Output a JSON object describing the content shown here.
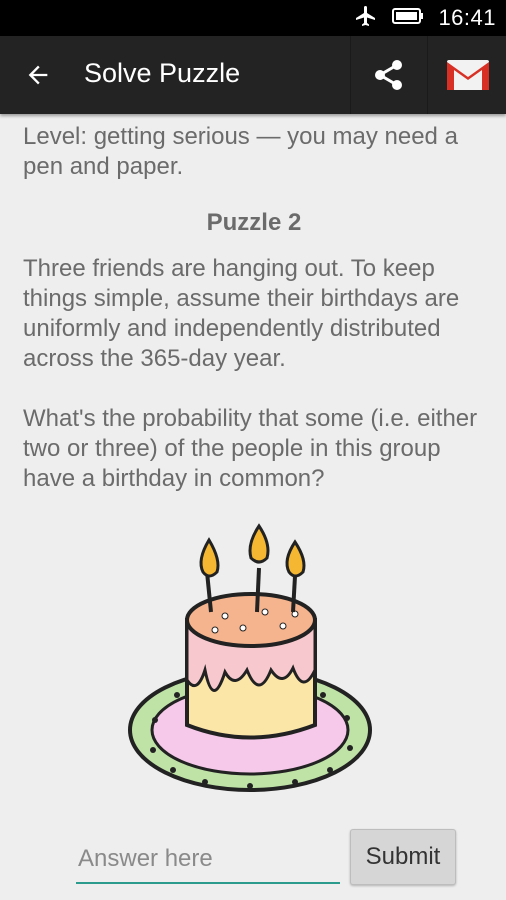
{
  "status": {
    "time": "16:41"
  },
  "appbar": {
    "title": "Solve Puzzle",
    "back_icon": "arrow-left-icon",
    "share_icon": "share-icon",
    "gmail_icon": "gmail-icon"
  },
  "content": {
    "level": "Level: getting serious — you may need a pen and paper.",
    "puzzle_title": "Puzzle 2",
    "paragraph1": "Three friends are hanging out. To keep things simple, assume their birthdays are uniformly and independently distributed across the 365-day year.",
    "paragraph2": "What's the probability that some (i.e. either two or three) of the people in this group have a birthday in common?"
  },
  "answer": {
    "placeholder": "Answer here",
    "value": "",
    "submit_label": "Submit"
  },
  "colors": {
    "input_underline": "#2a9b8c",
    "appbar": "#232323",
    "gmail_red": "#d93025"
  }
}
